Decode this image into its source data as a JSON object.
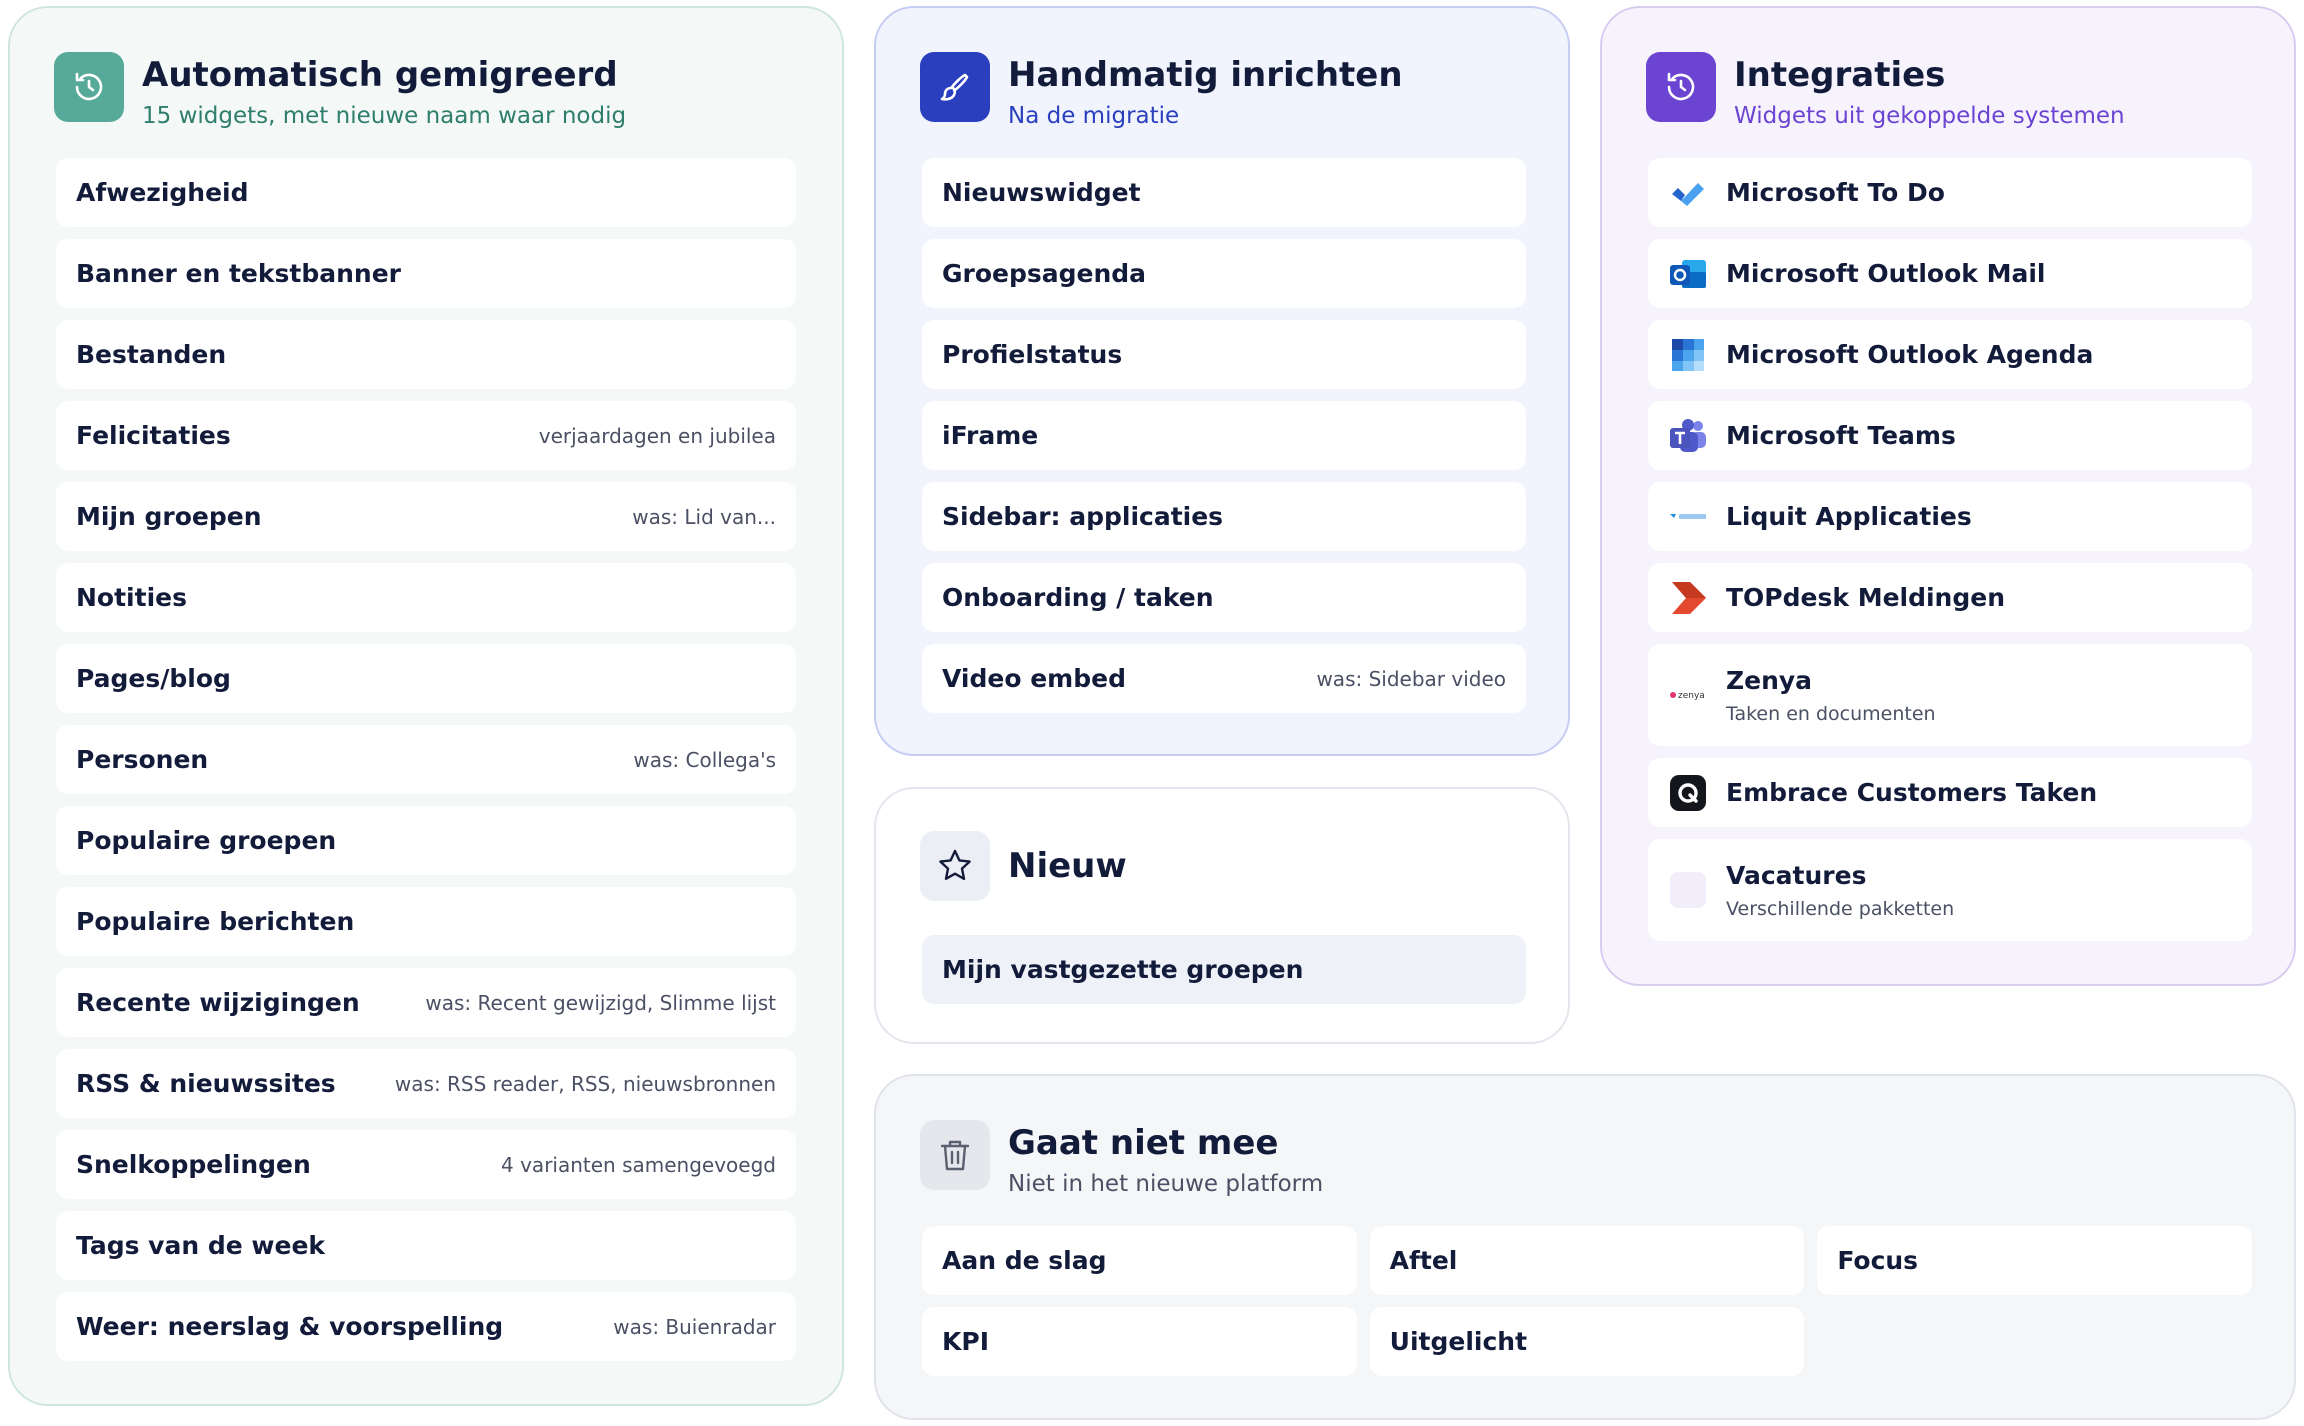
{
  "auto": {
    "title": "Automatisch gemigreerd",
    "subtitle": "15 widgets, met nieuwe naam waar nodig",
    "items": [
      {
        "label": "Afwezigheid",
        "note": ""
      },
      {
        "label": "Banner en tekstbanner",
        "note": ""
      },
      {
        "label": "Bestanden",
        "note": ""
      },
      {
        "label": "Felicitaties",
        "note": "verjaardagen en jubilea"
      },
      {
        "label": "Mijn groepen",
        "note": "was: Lid van..."
      },
      {
        "label": "Notities",
        "note": ""
      },
      {
        "label": "Pages/blog",
        "note": ""
      },
      {
        "label": "Personen",
        "note": "was: Collega's"
      },
      {
        "label": "Populaire groepen",
        "note": ""
      },
      {
        "label": "Populaire berichten",
        "note": ""
      },
      {
        "label": "Recente wijzigingen",
        "note": "was: Recent gewijzigd, Slimme lijst"
      },
      {
        "label": "RSS & nieuwssites",
        "note": "was: RSS reader, RSS, nieuwsbronnen"
      },
      {
        "label": "Snelkoppelingen",
        "note": "4 varianten samengevoegd"
      },
      {
        "label": "Tags van de week",
        "note": ""
      },
      {
        "label": "Weer: neerslag & voorspelling",
        "note": "was: Buienradar"
      }
    ]
  },
  "hand": {
    "title": "Handmatig inrichten",
    "subtitle": "Na de migratie",
    "items": [
      {
        "label": "Nieuwswidget",
        "note": ""
      },
      {
        "label": "Groepsagenda",
        "note": ""
      },
      {
        "label": "Profielstatus",
        "note": ""
      },
      {
        "label": "iFrame",
        "note": ""
      },
      {
        "label": "Sidebar: applicaties",
        "note": ""
      },
      {
        "label": "Onboarding / taken",
        "note": ""
      },
      {
        "label": "Video embed",
        "note": "was: Sidebar video"
      }
    ]
  },
  "nieuw": {
    "title": "Nieuw",
    "items": [
      {
        "label": "Mijn vastgezette groepen"
      }
    ]
  },
  "integ": {
    "title": "Integraties",
    "subtitle": "Widgets uit gekoppelde systemen",
    "items": [
      {
        "label": "Microsoft To Do",
        "sub": "",
        "icon": "microsoft-todo-icon"
      },
      {
        "label": "Microsoft Outlook Mail",
        "sub": "",
        "icon": "outlook-mail-icon"
      },
      {
        "label": "Microsoft Outlook Agenda",
        "sub": "",
        "icon": "outlook-calendar-icon"
      },
      {
        "label": "Microsoft Teams",
        "sub": "",
        "icon": "teams-icon"
      },
      {
        "label": "Liquit Applicaties",
        "sub": "",
        "icon": "liquit-icon"
      },
      {
        "label": "TOPdesk Meldingen",
        "sub": "",
        "icon": "topdesk-icon"
      },
      {
        "label": "Zenya",
        "sub": "Taken en documenten",
        "icon": "zenya-icon",
        "logo_text": "zenya"
      },
      {
        "label": "Embrace Customers Taken",
        "sub": "",
        "icon": "embrace-icon"
      },
      {
        "label": "Vacatures",
        "sub": "Verschillende pakketten",
        "icon": "vacatures-icon"
      }
    ]
  },
  "gaat": {
    "title": "Gaat niet mee",
    "subtitle": "Niet in het nieuwe platform",
    "items": [
      "Aan de slag",
      "Aftel",
      "Focus",
      "KPI",
      "Uitgelicht"
    ]
  },
  "colors": {
    "auto_accent": "#57aa9a",
    "hand_accent": "#2a3fbe",
    "integ_accent": "#6b44d2",
    "text_dark": "#131b3a"
  }
}
